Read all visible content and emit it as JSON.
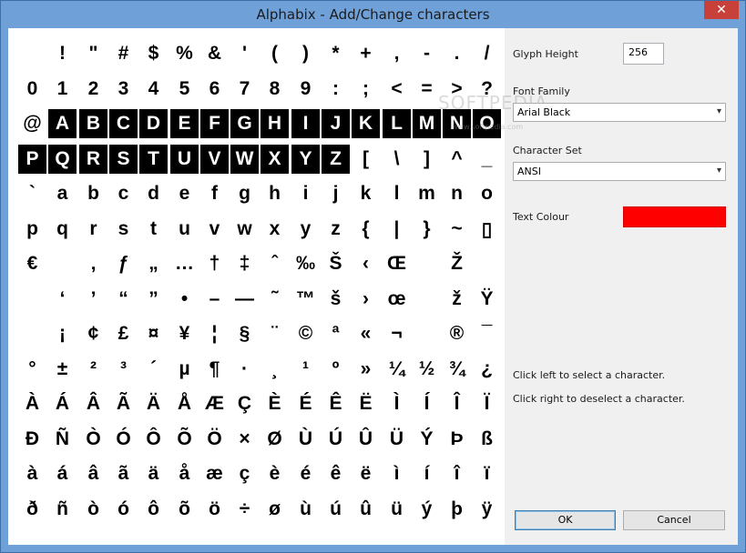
{
  "window": {
    "title": "Alphabix - Add/Change characters",
    "close_label": "✕"
  },
  "glyph_rows": [
    [
      " ",
      "!",
      "\"",
      "#",
      "$",
      "%",
      "&",
      "'",
      "(",
      ")",
      "*",
      "+",
      ",",
      "-",
      ".",
      "/"
    ],
    [
      "0",
      "1",
      "2",
      "3",
      "4",
      "5",
      "6",
      "7",
      "8",
      "9",
      ":",
      ";",
      "<",
      "=",
      ">",
      "?"
    ],
    [
      "@",
      "A",
      "B",
      "C",
      "D",
      "E",
      "F",
      "G",
      "H",
      "I",
      "J",
      "K",
      "L",
      "M",
      "N",
      "O"
    ],
    [
      "P",
      "Q",
      "R",
      "S",
      "T",
      "U",
      "V",
      "W",
      "X",
      "Y",
      "Z",
      "[",
      "\\",
      "]",
      "^",
      "_"
    ],
    [
      "`",
      "a",
      "b",
      "c",
      "d",
      "e",
      "f",
      "g",
      "h",
      "i",
      "j",
      "k",
      "l",
      "m",
      "n",
      "o"
    ],
    [
      "p",
      "q",
      "r",
      "s",
      "t",
      "u",
      "v",
      "w",
      "x",
      "y",
      "z",
      "{",
      "|",
      "}",
      "~",
      "▯"
    ],
    [
      "€",
      "",
      "‚",
      "ƒ",
      "„",
      "…",
      "†",
      "‡",
      "ˆ",
      "‰",
      "Š",
      "‹",
      "Œ",
      "",
      "Ž",
      ""
    ],
    [
      "",
      "‘",
      "’",
      "“",
      "”",
      "•",
      "–",
      "—",
      "˜",
      "™",
      "š",
      "›",
      "œ",
      "",
      "ž",
      "Ÿ"
    ],
    [
      "",
      "¡",
      "¢",
      "£",
      "¤",
      "¥",
      "¦",
      "§",
      "¨",
      "©",
      "ª",
      "«",
      "¬",
      "",
      "®",
      "¯"
    ],
    [
      "°",
      "±",
      "²",
      "³",
      "´",
      "µ",
      "¶",
      "·",
      "¸",
      "¹",
      "º",
      "»",
      "¼",
      "½",
      "¾",
      "¿"
    ],
    [
      "À",
      "Á",
      "Â",
      "Ã",
      "Ä",
      "Å",
      "Æ",
      "Ç",
      "È",
      "É",
      "Ê",
      "Ë",
      "Ì",
      "Í",
      "Î",
      "Ï"
    ],
    [
      "Ð",
      "Ñ",
      "Ò",
      "Ó",
      "Ô",
      "Õ",
      "Ö",
      "×",
      "Ø",
      "Ù",
      "Ú",
      "Û",
      "Ü",
      "Ý",
      "Þ",
      "ß"
    ],
    [
      "à",
      "á",
      "â",
      "ã",
      "ä",
      "å",
      "æ",
      "ç",
      "è",
      "é",
      "ê",
      "ë",
      "ì",
      "í",
      "î",
      "ï"
    ],
    [
      "ð",
      "ñ",
      "ò",
      "ó",
      "ô",
      "õ",
      "ö",
      "÷",
      "ø",
      "ù",
      "ú",
      "û",
      "ü",
      "ý",
      "þ",
      "ÿ"
    ]
  ],
  "selected_glyphs": [
    "A",
    "B",
    "C",
    "D",
    "E",
    "F",
    "G",
    "H",
    "I",
    "J",
    "K",
    "L",
    "M",
    "N",
    "O",
    "P",
    "Q",
    "R",
    "S",
    "T",
    "U",
    "V",
    "W",
    "X",
    "Y",
    "Z"
  ],
  "settings": {
    "glyph_height_label": "Glyph Height",
    "glyph_height_value": "256",
    "font_family_label": "Font Family",
    "font_family_value": "Arial Black",
    "character_set_label": "Character Set",
    "character_set_value": "ANSI",
    "text_colour_label": "Text Colour",
    "text_colour_value": "#FF0000"
  },
  "instructions": {
    "left": "Click left to select a character.",
    "right": "Click right to deselect a character."
  },
  "buttons": {
    "ok": "OK",
    "cancel": "Cancel"
  },
  "watermark": {
    "main": "SOFTPEDIA",
    "sub": "www.softpedia.com"
  },
  "icons": {
    "dropdown": "chevron-down-icon",
    "close": "close-icon"
  }
}
